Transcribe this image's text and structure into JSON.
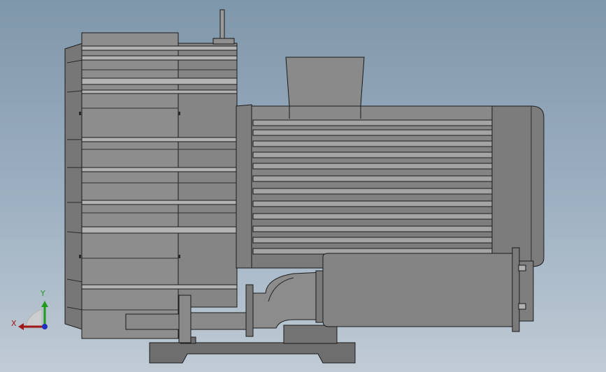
{
  "viewport": {
    "background_top": "#7f97aa",
    "background_bottom": "#c0cbd5"
  },
  "model": {
    "part_color": "#8c8c8c",
    "part_light": "#a5a5a5",
    "part_dark": "#5d5d5d",
    "edge_color": "#1a1a1a"
  },
  "triad": {
    "x_label": "X",
    "y_label": "Y",
    "x_color": "#a01818",
    "y_color": "#1f9a1f",
    "z_color": "#2030c0"
  }
}
